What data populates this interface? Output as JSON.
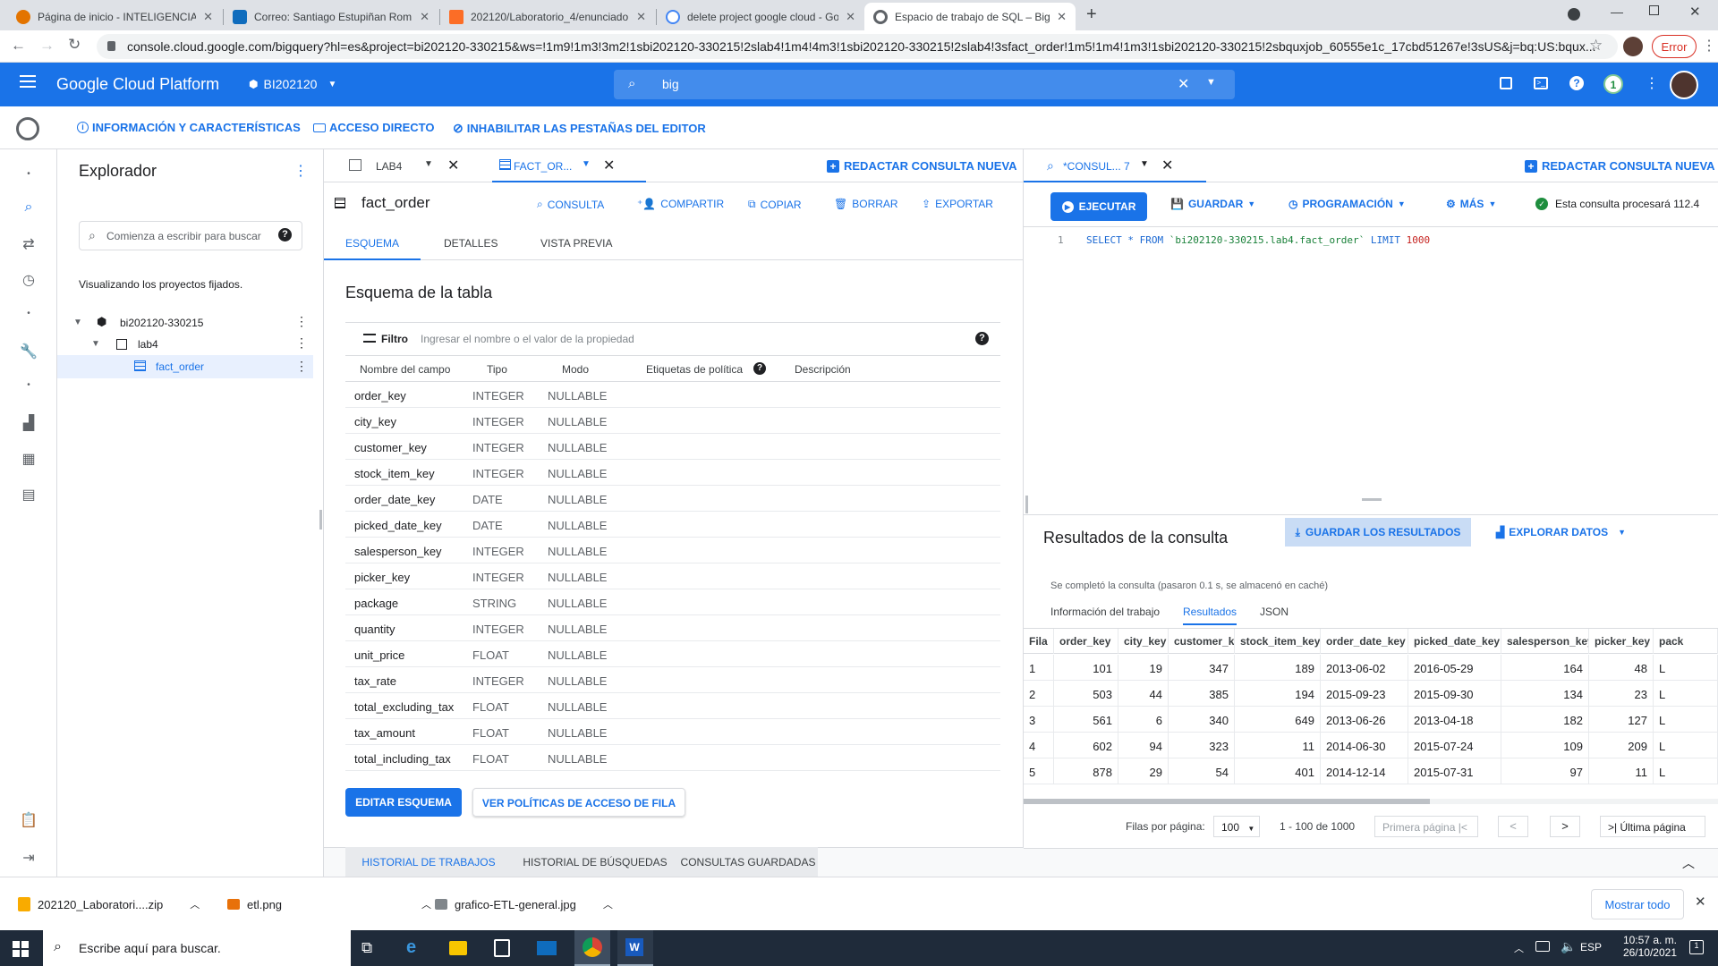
{
  "browser": {
    "tabs": [
      {
        "title": "Página de inicio - INTELIGENCIA",
        "color": "#e37400"
      },
      {
        "title": "Correo: Santiago Estupiñan Rom",
        "color": "#0f6cbd"
      },
      {
        "title": "202120/Laboratorio_4/enunciado",
        "color": "#fc6d26"
      },
      {
        "title": "delete project google cloud - Go",
        "color": "#4285f4"
      },
      {
        "title": "Espacio de trabajo de SQL – BigQ",
        "color": "#5f6368"
      }
    ],
    "url": "console.cloud.google.com/bigquery?hl=es&project=bi202120-330215&ws=!1m9!1m3!3m2!1sbi202120-330215!2slab4!1m4!4m3!1sbi202120-330215!2slab4!3sfact_order!1m5!1m4!1m3!1sbi202120-330215!2sbquxjob_60555e1c_17cbd51267e!3sUS&j=bq:US:bqux...",
    "error_label": "Error"
  },
  "gcp": {
    "title": "Google Cloud Platform",
    "project": "BI202120",
    "search_value": "big",
    "notif_count": "1"
  },
  "subheader": {
    "info": "INFORMACIÓN Y CARACTERÍSTICAS",
    "shortcut": "ACCESO DIRECTO",
    "disable_tabs": "INHABILITAR LAS PESTAÑAS DEL EDITOR"
  },
  "explorer": {
    "title": "Explorador",
    "search_placeholder": "Comienza a escribir para buscar",
    "pinned_note": "Visualizando los proyectos fijados.",
    "project": "bi202120-330215",
    "dataset": "lab4",
    "table": "fact_order"
  },
  "center": {
    "tab1": "LAB4",
    "tab2": "FACT_OR...",
    "new_query": "REDACTAR CONSULTA NUEVA",
    "table_name": "fact_order",
    "actions": {
      "query": "CONSULTA",
      "share": "COMPARTIR",
      "copy": "COPIAR",
      "delete": "BORRAR",
      "export": "EXPORTAR"
    },
    "subtabs": [
      "ESQUEMA",
      "DETALLES",
      "VISTA PREVIA"
    ],
    "schema_title": "Esquema de la tabla",
    "filter_label": "Filtro",
    "filter_placeholder": "Ingresar el nombre o el valor de la propiedad",
    "columns": [
      "Nombre del campo",
      "Tipo",
      "Modo",
      "Etiquetas de política",
      "Descripción"
    ],
    "rows": [
      {
        "name": "order_key",
        "type": "INTEGER",
        "mode": "NULLABLE"
      },
      {
        "name": "city_key",
        "type": "INTEGER",
        "mode": "NULLABLE"
      },
      {
        "name": "customer_key",
        "type": "INTEGER",
        "mode": "NULLABLE"
      },
      {
        "name": "stock_item_key",
        "type": "INTEGER",
        "mode": "NULLABLE"
      },
      {
        "name": "order_date_key",
        "type": "DATE",
        "mode": "NULLABLE"
      },
      {
        "name": "picked_date_key",
        "type": "DATE",
        "mode": "NULLABLE"
      },
      {
        "name": "salesperson_key",
        "type": "INTEGER",
        "mode": "NULLABLE"
      },
      {
        "name": "picker_key",
        "type": "INTEGER",
        "mode": "NULLABLE"
      },
      {
        "name": "package",
        "type": "STRING",
        "mode": "NULLABLE"
      },
      {
        "name": "quantity",
        "type": "INTEGER",
        "mode": "NULLABLE"
      },
      {
        "name": "unit_price",
        "type": "FLOAT",
        "mode": "NULLABLE"
      },
      {
        "name": "tax_rate",
        "type": "INTEGER",
        "mode": "NULLABLE"
      },
      {
        "name": "total_excluding_tax",
        "type": "FLOAT",
        "mode": "NULLABLE"
      },
      {
        "name": "tax_amount",
        "type": "FLOAT",
        "mode": "NULLABLE"
      },
      {
        "name": "total_including_tax",
        "type": "FLOAT",
        "mode": "NULLABLE"
      }
    ],
    "edit_schema": "EDITAR ESQUEMA",
    "row_policies": "VER POLÍTICAS DE ACCESO DE FILA",
    "bottom_tabs": [
      "HISTORIAL DE TRABAJOS",
      "HISTORIAL DE BÚSQUEDAS",
      "CONSULTAS GUARDADAS"
    ]
  },
  "right": {
    "tab": "*CONSUL... 7",
    "new_query": "REDACTAR CONSULTA NUEVA",
    "run": "EJECUTAR",
    "save": "GUARDAR",
    "schedule": "PROGRAMACIÓN",
    "more": "MÁS",
    "status": "Esta consulta procesará 112.4",
    "line_no": "1",
    "sql_kw1": "SELECT * FROM",
    "sql_table": "`bi202120-330215.lab4.fact_order`",
    "sql_kw2": "LIMIT",
    "sql_num": "1000",
    "results_title": "Resultados de la consulta",
    "save_results": "GUARDAR LOS RESULTADOS",
    "explore": "EXPLORAR DATOS",
    "completed": "Se completó la consulta (pasaron 0.1 s, se almacenó en caché)",
    "result_tabs": [
      "Información del trabajo",
      "Resultados",
      "JSON"
    ],
    "headers": [
      "Fila",
      "order_key",
      "city_key",
      "customer_key",
      "stock_item_key",
      "order_date_key",
      "picked_date_key",
      "salesperson_key",
      "picker_key",
      "pack"
    ],
    "rows": [
      [
        "1",
        "101",
        "19",
        "347",
        "189",
        "2013-06-02",
        "2016-05-29",
        "164",
        "48",
        "L"
      ],
      [
        "2",
        "503",
        "44",
        "385",
        "194",
        "2015-09-23",
        "2015-09-30",
        "134",
        "23",
        "L"
      ],
      [
        "3",
        "561",
        "6",
        "340",
        "649",
        "2013-06-26",
        "2013-04-18",
        "182",
        "127",
        "L"
      ],
      [
        "4",
        "602",
        "94",
        "323",
        "11",
        "2014-06-30",
        "2015-07-24",
        "109",
        "209",
        "L"
      ],
      [
        "5",
        "878",
        "29",
        "54",
        "401",
        "2014-12-14",
        "2015-07-31",
        "97",
        "11",
        "L"
      ]
    ],
    "rows_per_page_label": "Filas por página:",
    "rows_per_page": "100",
    "range": "1 - 100 de 1000",
    "first_page": "Primera página",
    "last_page": "Última página"
  },
  "downloads": {
    "items": [
      "202120_Laboratori....zip",
      "etl.png",
      "grafico-ETL-general.jpg"
    ],
    "show_all": "Mostrar todo"
  },
  "taskbar": {
    "search": "Escribe aquí para buscar.",
    "lang": "ESP",
    "time": "10:57 a. m.",
    "date": "26/10/2021"
  }
}
